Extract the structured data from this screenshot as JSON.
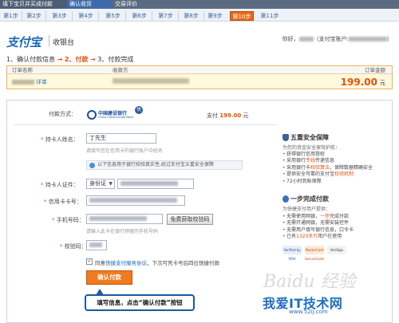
{
  "topbar": {
    "items": [
      "填下宝贝并买成付款",
      "确认收货",
      "交易评价"
    ]
  },
  "steps": {
    "items": [
      "第1步",
      "第2步",
      "第3步",
      "第4步",
      "第5步",
      "第6步",
      "第7步",
      "第8步",
      "第9步",
      "第10步",
      "第11步"
    ],
    "active_index": 9
  },
  "header": {
    "logo": "支付宝",
    "page_title": "收银台",
    "greeting": "你好，",
    "account_prefix": "（支付宝账户:",
    "account_suffix": "）"
  },
  "progress": {
    "step1": "1、确认付款信息",
    "arrow1": "→",
    "step2": "2、付款",
    "arrow2": "→",
    "step3": "3、付款完成"
  },
  "order": {
    "headers": {
      "name": "订单名称",
      "payee": "收款方",
      "amount": "订单金额"
    },
    "detail_link": "详单",
    "amount": "199.00",
    "currency": "元"
  },
  "payment": {
    "method_label": "付款方式：",
    "bank_name": "中国建设银行",
    "bank_en": "China Construction Bank",
    "quick_badge": "快",
    "pay_prefix": "支付",
    "pay_amount": "199.00",
    "pay_suffix": "元"
  },
  "form": {
    "holder_label": "持卡人姓名：",
    "holder_value": "丁先生",
    "holder_hint": "请填写您在信用卡的银行账户中姓名",
    "verify_note": "以下信息用于银行校验真实性,经过支付宝五重安全保障",
    "id_label": "持卡人证件：",
    "id_type": "身份证",
    "card_label": "信用卡卡号：",
    "phone_label": "手机号码：",
    "sms_button": "免费获取校验码",
    "phone_hint": "请输入此卡在银行预留的手机号码",
    "code_label": "校验码：",
    "agree_prefix": "同意",
    "agree_link": "快捷支付服务协议",
    "agree_suffix": "，下次可凭卡号后四位快捷付款",
    "confirm_button": "确认付款"
  },
  "sidebar": {
    "security_title": "五重安全保障",
    "security_sub": "为您的资金安全保驾护航：",
    "security_items": [
      "获得银行信用授权",
      "采用银行专线传递信息",
      "采用银行卡校验算法，保障数据精确安全",
      "提供安全可靠的支付宝校验机制",
      "72小时到账保障"
    ],
    "fast_title": "一步完成付款",
    "fast_sub": "为快捷支付用户提供：",
    "fast_items": [
      "无需使用网银，一步完成付款",
      "无需开通网银，无需安装控件",
      "无需用户填写银行信息，口令卡",
      "已有1320多万用户在使用"
    ],
    "certs": [
      "Verified by VISA",
      "MasterCard SecureCode",
      "VeriSign"
    ]
  },
  "annotation": {
    "text": "填写信息，点击“确认付款”按钮"
  },
  "watermark": {
    "baidu": "Baidu 经验",
    "site": "我爱IT技术网",
    "url": "www.52ij.com"
  }
}
